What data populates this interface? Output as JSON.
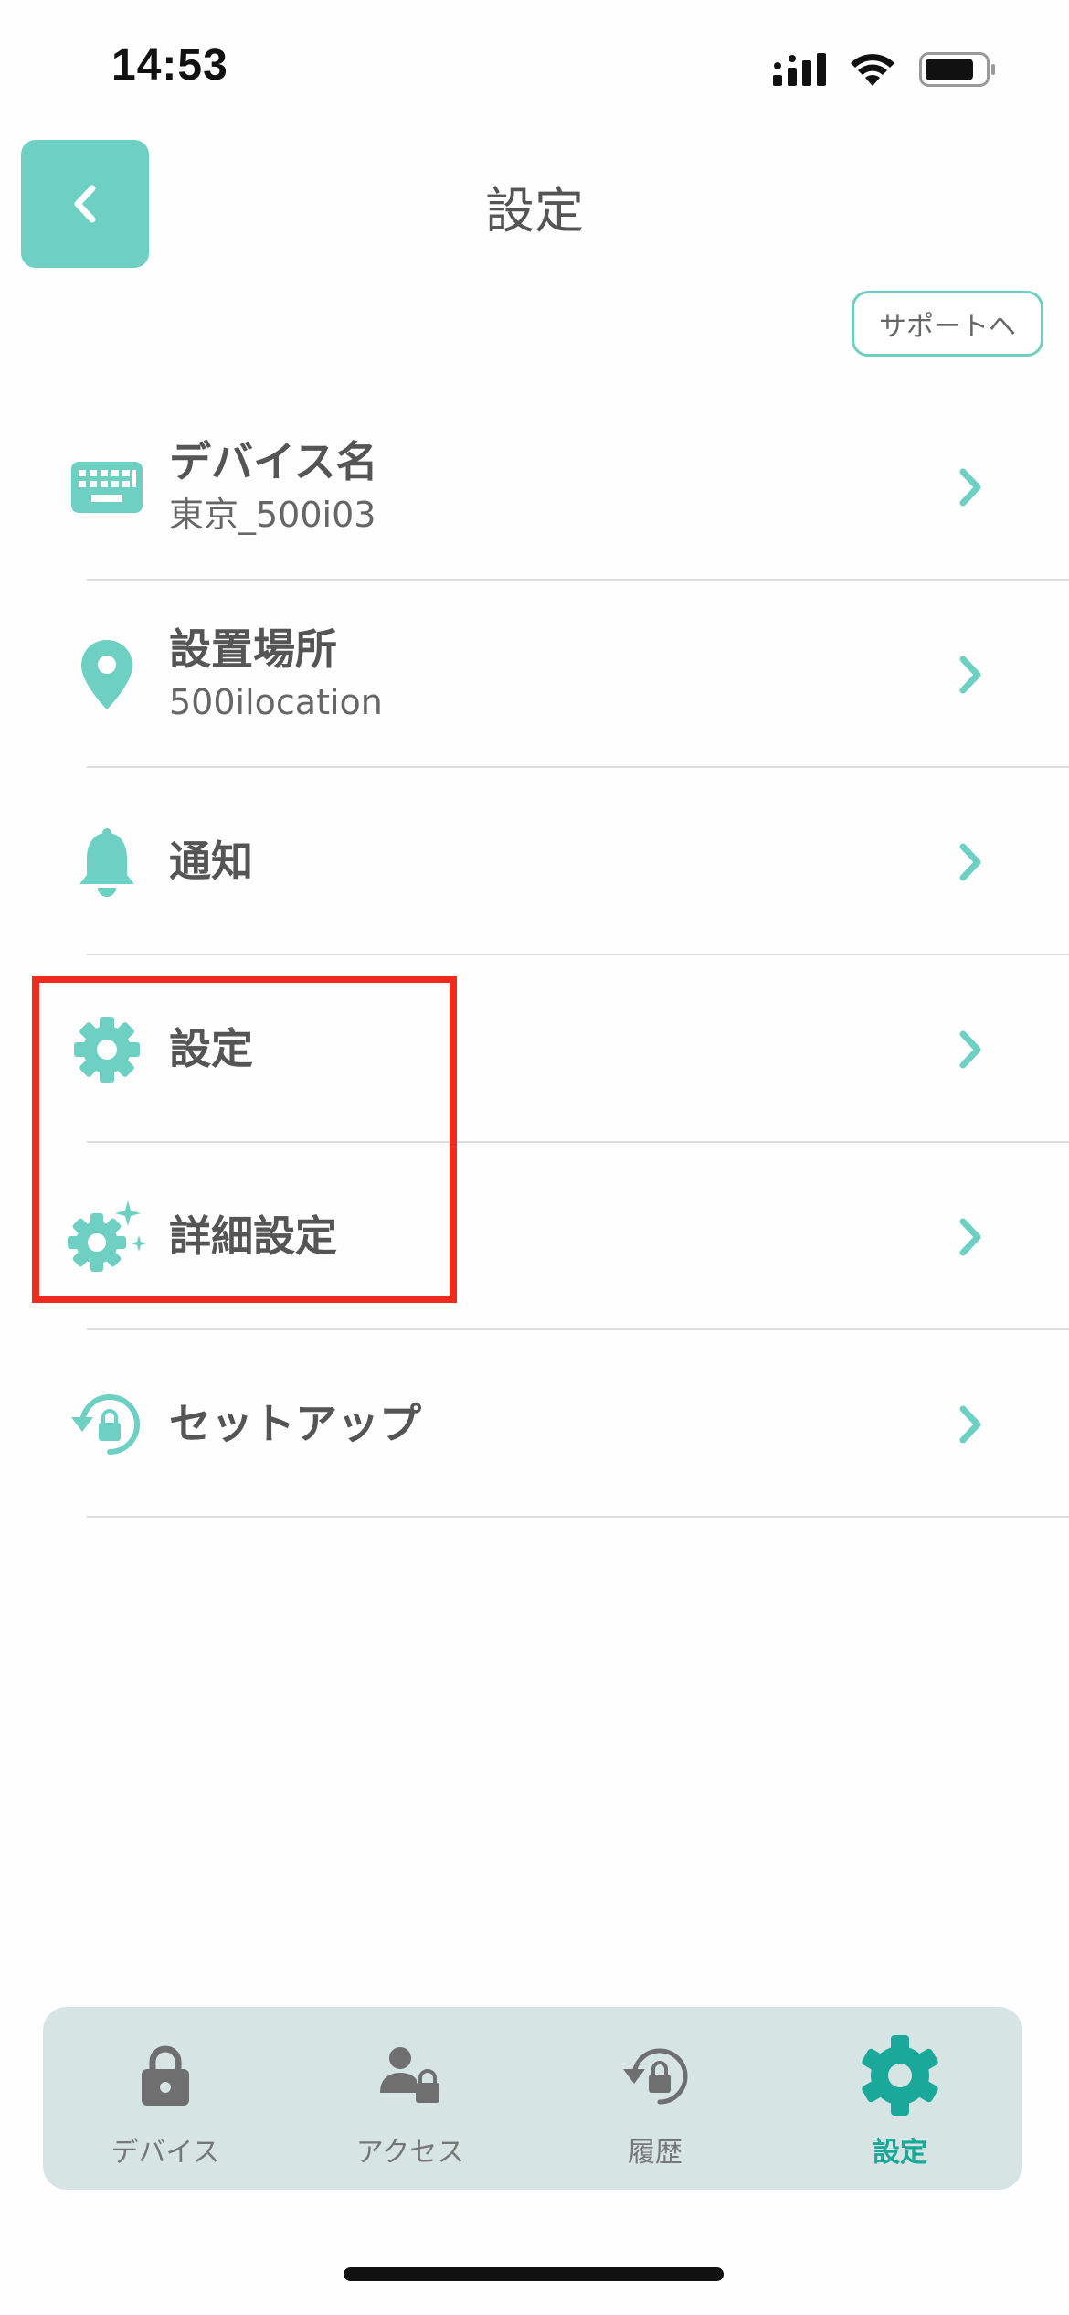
{
  "status_bar": {
    "time": "14:53"
  },
  "header": {
    "back_icon": "chevron-left-icon",
    "title": "設定",
    "support_label": "サポートへ"
  },
  "colors": {
    "accent": "#6dd0c2",
    "accent_dark": "#1aa89a",
    "text": "#555555",
    "highlight": "#f02b1d",
    "tab_bar_bg": "#d6e4e3"
  },
  "menu": {
    "items": [
      {
        "label": "デバイス名",
        "sub": "東京_500i03",
        "icon": "keyboard-icon"
      },
      {
        "label": "設置場所",
        "sub": "500ilocation",
        "icon": "location-pin-icon"
      },
      {
        "label": "通知",
        "icon": "bell-icon"
      },
      {
        "label": "設定",
        "icon": "gear-icon"
      },
      {
        "label": "詳細設定",
        "icon": "gear-sparkle-icon"
      },
      {
        "label": "セットアップ",
        "icon": "setup-lock-icon"
      }
    ]
  },
  "tab_bar": {
    "tabs": [
      {
        "label": "デバイス",
        "icon": "lock-icon",
        "active": false
      },
      {
        "label": "アクセス",
        "icon": "user-lock-icon",
        "active": false
      },
      {
        "label": "履歴",
        "icon": "history-icon",
        "active": false
      },
      {
        "label": "設定",
        "icon": "gear-icon",
        "active": true
      }
    ]
  }
}
